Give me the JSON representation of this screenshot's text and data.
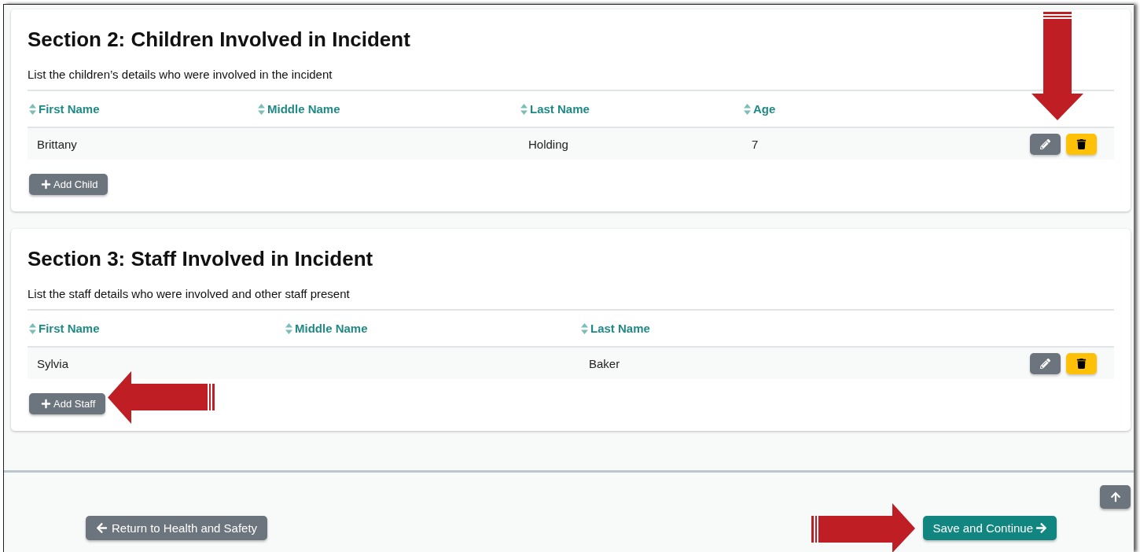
{
  "sections": [
    {
      "title": "Section 2: Children Involved in Incident",
      "description": "List the children’s details who were involved in the incident",
      "columns": [
        "First Name",
        "Middle Name",
        "Last Name",
        "Age"
      ],
      "rows": [
        {
          "cells": [
            "Brittany",
            null,
            "Holding",
            "7"
          ]
        }
      ],
      "add_button": "Add Child"
    },
    {
      "title": "Section 3: Staff Involved in Incident",
      "description": "List the staff details who were involved and other staff present",
      "columns": [
        "First Name",
        "Middle Name",
        "Last Name"
      ],
      "rows": [
        {
          "cells": [
            "Sylvia",
            null,
            "Baker"
          ]
        }
      ],
      "add_button": "Add Staff"
    }
  ],
  "footer": {
    "back_button": "Return to Health and Safety",
    "next_button": "Save and Continue"
  }
}
